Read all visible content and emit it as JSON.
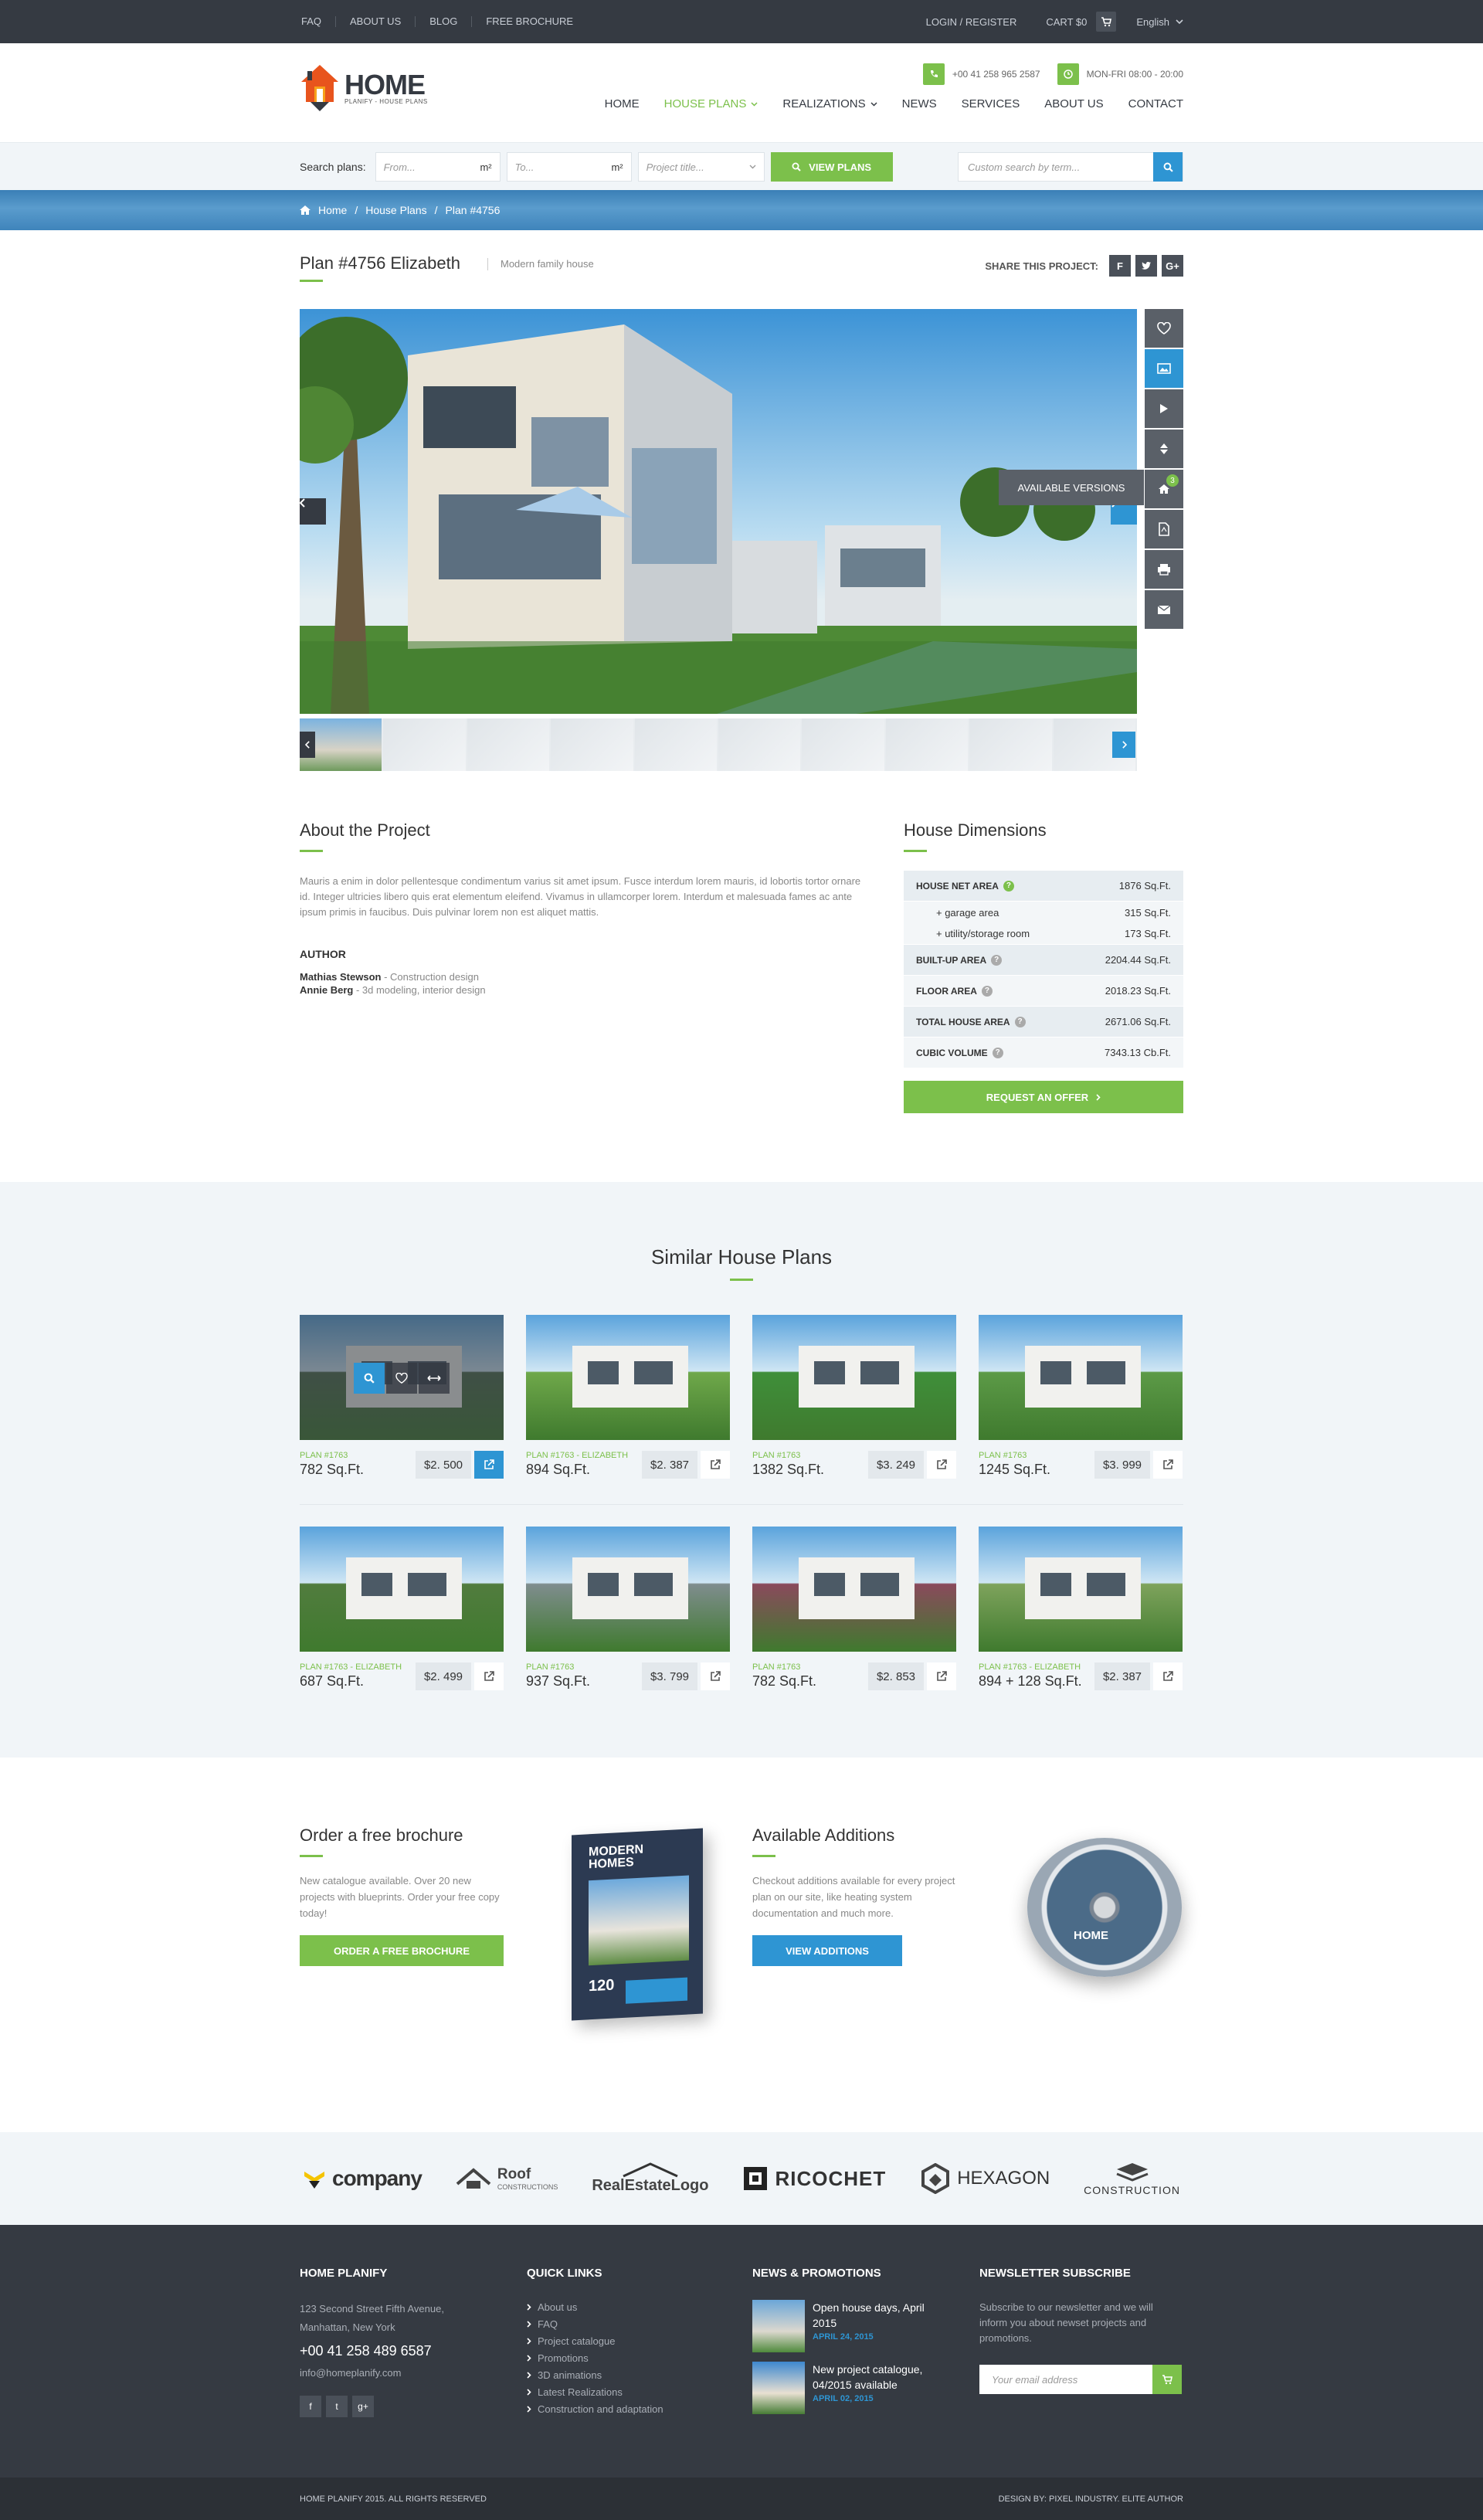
{
  "topbar": {
    "links": [
      "FAQ",
      "ABOUT US",
      "BLOG",
      "FREE BROCHURE"
    ],
    "login": "LOGIN / REGISTER",
    "cart": "CART $0",
    "language": "English"
  },
  "header": {
    "logo_text": "HOME",
    "logo_tagline": "PLANIFY - HOUSE PLANS",
    "phone": "+00 41 258 965 2587",
    "hours": "MON-FRI 08:00 - 20:00",
    "nav": [
      "HOME",
      "HOUSE PLANS",
      "REALIZATIONS",
      "NEWS",
      "SERVICES",
      "ABOUT US",
      "CONTACT"
    ]
  },
  "search": {
    "label": "Search plans:",
    "from_placeholder": "From...",
    "to_placeholder": "To...",
    "unit": "m²",
    "title_placeholder": "Project title...",
    "button": "VIEW PLANS",
    "custom_placeholder": "Custom search by term..."
  },
  "breadcrumb": [
    "Home",
    "Plan #4756"
  ],
  "breadcrumb_middle": "House Plans",
  "project": {
    "title": "Plan #4756 Elizabeth",
    "subtitle": "Modern family house",
    "share_label": "SHARE THIS PROJECT:",
    "available_versions": "AVAILABLE VERSIONS",
    "versions_count": "3"
  },
  "about": {
    "title": "About the Project",
    "text": "Mauris a enim in dolor pellentesque condimentum varius sit amet ipsum. Fusce interdum lorem mauris, id lobortis tortor ornare id. Integer ultricies libero quis erat elementum eleifend. Vivamus in ullamcorper lorem. Interdum et malesuada fames ac ante ipsum primis in faucibus. Duis pulvinar lorem non est aliquet mattis.",
    "author_label": "AUTHOR",
    "authors": [
      {
        "name": "Mathias Stewson",
        "role": " - Construction design"
      },
      {
        "name": "Annie Berg",
        "role": " - 3d modeling, interior design"
      }
    ]
  },
  "dimensions": {
    "title": "House Dimensions",
    "rows": [
      {
        "label": "HOUSE NET AREA",
        "value": "1876 Sq.Ft."
      },
      {
        "label": "+ garage area",
        "value": "315 Sq.Ft."
      },
      {
        "label": "+ utility/storage room",
        "value": "173 Sq.Ft."
      },
      {
        "label": "BUILT-UP AREA",
        "value": "2204.44 Sq.Ft."
      },
      {
        "label": "FLOOR AREA",
        "value": "2018.23 Sq.Ft."
      },
      {
        "label": "TOTAL HOUSE AREA",
        "value": "2671.06 Sq.Ft."
      },
      {
        "label": "CUBIC VOLUME",
        "value": "7343.13 Cb.Ft."
      }
    ],
    "offer_button": "REQUEST AN OFFER"
  },
  "similar": {
    "title": "Similar House Plans",
    "cards": [
      {
        "plan": "PLAN #1763",
        "size": "782 Sq.Ft.",
        "price": "$2. 500",
        "img": "#4d6a4c"
      },
      {
        "plan": "PLAN #1763 - ELIZABETH",
        "size": "894 Sq.Ft.",
        "price": "$2. 387",
        "img": "#6fa84a"
      },
      {
        "plan": "PLAN #1763",
        "size": "1382 Sq.Ft.",
        "price": "$3. 249",
        "img": "#3f8f3a"
      },
      {
        "plan": "PLAN #1763",
        "size": "1245 Sq.Ft.",
        "price": "$3. 999",
        "img": "#5c9a47"
      },
      {
        "plan": "PLAN #1763 - ELIZABETH",
        "size": "687 Sq.Ft.",
        "price": "$2. 499",
        "img": "#517c3e"
      },
      {
        "plan": "PLAN #1763",
        "size": "937 Sq.Ft.",
        "price": "$3. 799",
        "img": "#7f8d8e"
      },
      {
        "plan": "PLAN #1763",
        "size": "782 Sq.Ft.",
        "price": "$2. 853",
        "img": "#8a4a5c"
      },
      {
        "plan": "PLAN #1763 - ELIZABETH",
        "size": "894 + 128 Sq.Ft.",
        "price": "$2. 387",
        "img": "#7ea35c"
      }
    ]
  },
  "brochure": {
    "title": "Order a free brochure",
    "text": "New catalogue available. Over 20 new projects with blueprints. Order your free copy today!",
    "button": "ORDER A FREE BROCHURE",
    "book_title": "MODERN HOMES",
    "book_count": "120"
  },
  "additions": {
    "title": "Available Additions",
    "text": "Checkout additions available for every project plan on our site, like heating system documentation and much more.",
    "button": "VIEW ADDITIONS",
    "disc_text": "HOME"
  },
  "partners": [
    "company",
    "Roof",
    "CONSTRUCTIONS",
    "RealEstateLogo",
    "RICOCHET",
    "HEXAGON",
    "CONSTRUCTION"
  ],
  "footer": {
    "col1_title": "HOME PLANIFY",
    "address1": "123 Second Street Fifth Avenue,",
    "address2": "Manhattan, New York",
    "phone": "+00 41 258 489 6587",
    "email": "info@homeplanify.com",
    "col2_title": "QUICK LINKS",
    "links": [
      "About us",
      "FAQ",
      "Project catalogue",
      "Promotions",
      "3D animations",
      "Latest Realizations",
      "Construction and adaptation"
    ],
    "col3_title": "NEWS & PROMOTIONS",
    "news": [
      {
        "title": "Open house days, April 2015",
        "date": "APRIL 24, 2015"
      },
      {
        "title": "New project catalogue, 04/2015 available",
        "date": "APRIL 02, 2015"
      }
    ],
    "col4_title": "NEWSLETTER SUBSCRIBE",
    "newsletter_text": "Subscribe to our newsletter and we will inform you about newset projects and promotions.",
    "email_placeholder": "Your email address",
    "copyright": "HOME PLANIFY 2015. ALL RIGHTS RESERVED",
    "credits": "DESIGN BY: PIXEL INDUSTRY. ELITE AUTHOR"
  },
  "colors": {
    "accent": "#7cc04b",
    "blue": "#2e95d3",
    "dark": "#353a42"
  }
}
